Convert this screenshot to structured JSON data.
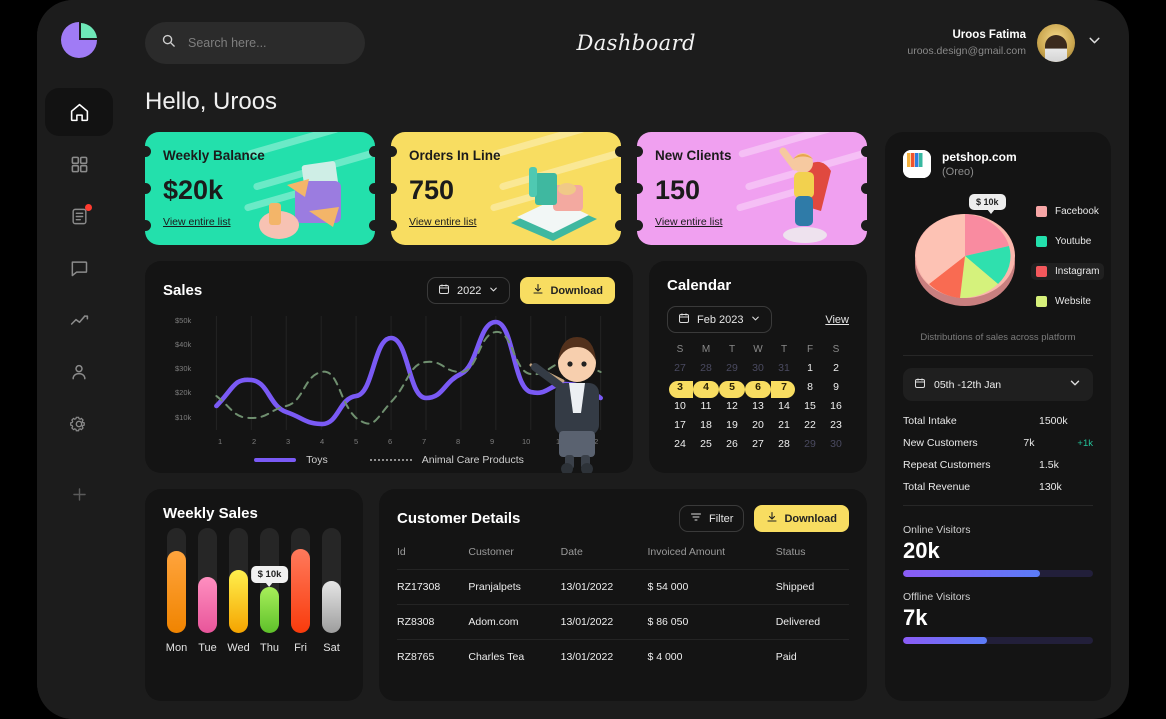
{
  "brand": {
    "logo_icon": "pie-chart-logo"
  },
  "sidebar": {
    "items": [
      {
        "icon": "home-icon",
        "name": "home",
        "active": true
      },
      {
        "icon": "grid-icon",
        "name": "dashboard-grid",
        "active": false
      },
      {
        "icon": "document-icon",
        "name": "documents",
        "active": false,
        "badge": true
      },
      {
        "icon": "chat-icon",
        "name": "messages",
        "active": false
      },
      {
        "icon": "trending-up-icon",
        "name": "analytics",
        "active": false
      },
      {
        "icon": "user-icon",
        "name": "profile",
        "active": false
      },
      {
        "icon": "gear-icon",
        "name": "settings",
        "active": false
      },
      {
        "icon": "plus-icon",
        "name": "add",
        "active": false
      }
    ]
  },
  "topbar": {
    "search_placeholder": "Search here...",
    "search_value": "",
    "search_icon": "search-icon",
    "title": "Dashboard",
    "user_name": "Uroos Fatima",
    "user_email": "uroos.design@gmail.com",
    "chevron_icon": "chevron-down-icon"
  },
  "greeting": "Hello, Uroos",
  "tickets": [
    {
      "label": "Weekly Balance",
      "value": "$20k",
      "link": "View entire list",
      "color": "#23e0ac"
    },
    {
      "label": "Orders In Line",
      "value": "750",
      "link": "View entire list",
      "color": "#f8dd61"
    },
    {
      "label": "New Clients",
      "value": "150",
      "link": "View entire list",
      "color": "#f0a0f0"
    }
  ],
  "sales": {
    "title": "Sales",
    "year_selector": "2022",
    "calendar_icon": "calendar-icon",
    "chevron_icon": "chevron-down-icon",
    "download_label": "Download",
    "download_icon": "download-icon"
  },
  "chart_data": {
    "type": "line",
    "title": "Sales",
    "xlabel": "",
    "ylabel": "",
    "x": [
      1,
      2,
      3,
      4,
      5,
      6,
      7,
      8,
      9,
      10,
      11,
      12
    ],
    "xticklabels": [
      "1",
      "2",
      "3",
      "4",
      "5",
      "6",
      "7",
      "8",
      "9",
      "10",
      "11",
      "12"
    ],
    "yticklabels": [
      "$10k",
      "$20k",
      "$30k",
      "$40k",
      "$50k"
    ],
    "ylim": [
      5000,
      55000
    ],
    "grid": true,
    "legend_position": "bottom",
    "series": [
      {
        "name": "Toys",
        "style": "solid",
        "color": "#7a5af5",
        "values": [
          20000,
          26000,
          22000,
          13000,
          12000,
          22000,
          41000,
          24000,
          26000,
          49000,
          27000,
          27500
        ]
      },
      {
        "name": "Animal Care Products",
        "style": "dashed",
        "color": "#5f7a5f",
        "values": [
          24000,
          16000,
          18000,
          28000,
          20000,
          11000,
          22000,
          31000,
          29000,
          44000,
          30000,
          30500
        ]
      }
    ]
  },
  "calendar": {
    "title": "Calendar",
    "month_selector": "Feb  2023",
    "calendar_icon": "calendar-icon",
    "chevron_icon": "chevron-down-icon",
    "view_label": "View",
    "weekdays": [
      "S",
      "M",
      "T",
      "W",
      "T",
      "F",
      "S"
    ],
    "weeks": [
      [
        {
          "d": "27",
          "mute": true
        },
        {
          "d": "28",
          "mute": true
        },
        {
          "d": "29",
          "mute": true
        },
        {
          "d": "30",
          "mute": true
        },
        {
          "d": "31",
          "mute": true
        },
        {
          "d": "1"
        },
        {
          "d": "2"
        }
      ],
      [
        {
          "d": "3",
          "hl": "start"
        },
        {
          "d": "4",
          "hl": "mid"
        },
        {
          "d": "5",
          "hl": "mid"
        },
        {
          "d": "6",
          "hl": "mid"
        },
        {
          "d": "7",
          "hl": "end"
        },
        {
          "d": "8"
        },
        {
          "d": "9"
        }
      ],
      [
        {
          "d": "10"
        },
        {
          "d": "11"
        },
        {
          "d": "12"
        },
        {
          "d": "13"
        },
        {
          "d": "14"
        },
        {
          "d": "15"
        },
        {
          "d": "16"
        }
      ],
      [
        {
          "d": "17"
        },
        {
          "d": "18"
        },
        {
          "d": "19"
        },
        {
          "d": "20"
        },
        {
          "d": "21"
        },
        {
          "d": "22"
        },
        {
          "d": "23"
        }
      ],
      [
        {
          "d": "24"
        },
        {
          "d": "25"
        },
        {
          "d": "26"
        },
        {
          "d": "27"
        },
        {
          "d": "28"
        },
        {
          "d": "29",
          "mute": true
        },
        {
          "d": "30",
          "mute": true
        }
      ]
    ]
  },
  "weekly_sales": {
    "title": "Weekly Sales",
    "tooltip": "$ 10k",
    "tooltip_on": "Thu",
    "bars": [
      {
        "day": "Mon",
        "pct": 78,
        "color_top": "#ffa43d",
        "color_bottom": "#f08400"
      },
      {
        "day": "Tue",
        "pct": 53,
        "color_top": "#ff8fc0",
        "color_bottom": "#e8559a"
      },
      {
        "day": "Wed",
        "pct": 60,
        "color_top": "#fff04d",
        "color_bottom": "#f5a400"
      },
      {
        "day": "Thu",
        "pct": 44,
        "color_top": "#a8ef5a",
        "color_bottom": "#5ec02a"
      },
      {
        "day": "Fri",
        "pct": 80,
        "color_top": "#ff7a5c",
        "color_bottom": "#f93b0c"
      },
      {
        "day": "Sat",
        "pct": 50,
        "color_top": "#e6e6e6",
        "color_bottom": "#9d9d9d"
      }
    ]
  },
  "customers": {
    "title": "Customer Details",
    "filter_label": "Filter",
    "filter_icon": "filter-icon",
    "download_label": "Download",
    "download_icon": "download-icon",
    "columns": [
      "Id",
      "Customer",
      "Date",
      "Invoiced Amount",
      "Status"
    ],
    "rows": [
      {
        "id": "RZ17308",
        "customer": "Pranjalpets",
        "date": "13/01/2022",
        "amount": "$ 54 000",
        "status": "Shipped",
        "status_class": "st-shipped"
      },
      {
        "id": "RZ8308",
        "customer": "Adom.com",
        "date": "13/01/2022",
        "amount": "$ 86 050",
        "status": "Delivered",
        "status_class": "st-delivered"
      },
      {
        "id": "RZ8765",
        "customer": "Charles Tea",
        "date": "13/01/2022",
        "amount": "$ 4 000",
        "status": "Paid",
        "status_class": "st-paid"
      }
    ]
  },
  "right_panel": {
    "shop_name": "petshop.com",
    "shop_sub": "(Oreo)",
    "shop_logo_icon": "petshop-logo-icon",
    "pie_tooltip": "$ 10k",
    "pie_caption": "Distributions of sales across platform",
    "pie_chart": {
      "type": "pie",
      "title": "Distributions of sales across platform",
      "labels": [
        "Facebook",
        "Youtube",
        "Instagram",
        "Website"
      ],
      "values": [
        40,
        22,
        10,
        28
      ],
      "colors": [
        "#f7a6a6",
        "#23e0ac",
        "#f4585c",
        "#d6f07a"
      ],
      "selected": "Instagram"
    },
    "date_range": "05th -12th Jan",
    "calendar_icon": "calendar-icon",
    "chevron_icon": "chevron-down-icon",
    "stats": [
      {
        "label": "Total Intake",
        "value": "1500k",
        "delta": ""
      },
      {
        "label": "New Customers",
        "value": "7k",
        "delta": "+1k"
      },
      {
        "label": "Repeat Customers",
        "value": "1.5k",
        "delta": ""
      },
      {
        "label": "Total Revenue",
        "value": "130k",
        "delta": ""
      }
    ],
    "visitors": [
      {
        "label": "Online Visitors",
        "value": "20k",
        "pct": 72
      },
      {
        "label": "Offline Visitors",
        "value": "7k",
        "pct": 44
      }
    ]
  }
}
